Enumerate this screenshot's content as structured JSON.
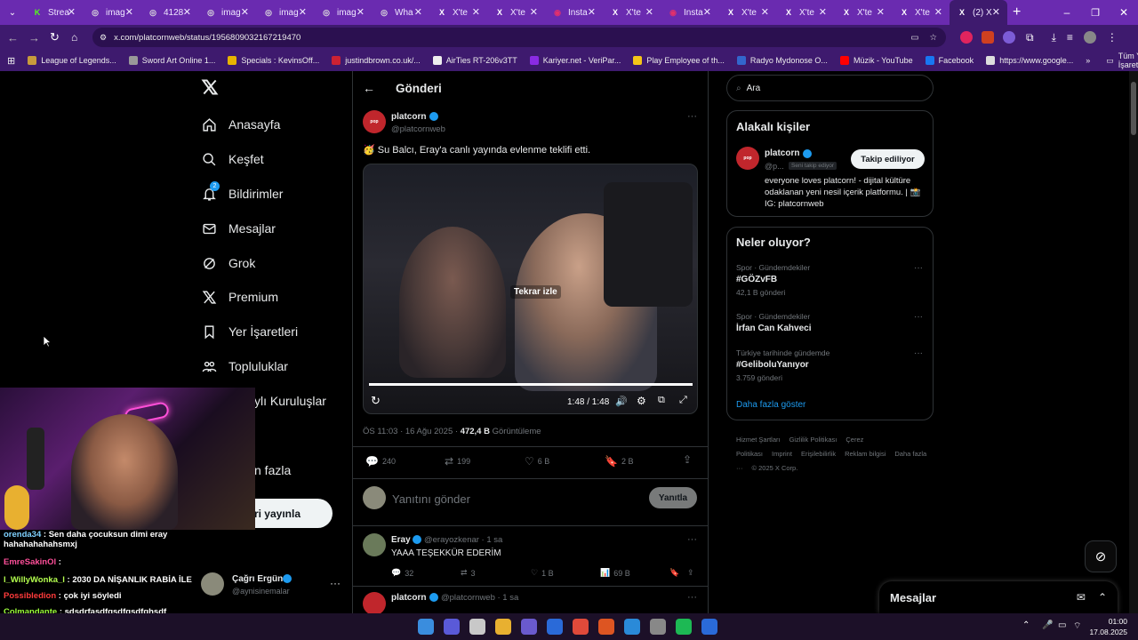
{
  "browser": {
    "tabs": [
      {
        "title": "Strea",
        "fav": "K",
        "color": "#53fc18"
      },
      {
        "title": "imag",
        "fav": "◎",
        "color": "#ddd"
      },
      {
        "title": "4128",
        "fav": "◎",
        "color": "#ddd"
      },
      {
        "title": "imag",
        "fav": "◎",
        "color": "#ddd"
      },
      {
        "title": "imag",
        "fav": "◎",
        "color": "#ddd"
      },
      {
        "title": "imag",
        "fav": "◎",
        "color": "#ddd"
      },
      {
        "title": "Wha",
        "fav": "◎",
        "color": "#ddd"
      },
      {
        "title": "X'te",
        "fav": "X",
        "color": "#fff"
      },
      {
        "title": "X'te",
        "fav": "X",
        "color": "#fff"
      },
      {
        "title": "Insta",
        "fav": "◉",
        "color": "#e1306c"
      },
      {
        "title": "X'te",
        "fav": "X",
        "color": "#fff"
      },
      {
        "title": "Insta",
        "fav": "◉",
        "color": "#e1306c"
      },
      {
        "title": "X'te",
        "fav": "X",
        "color": "#fff"
      },
      {
        "title": "X'te",
        "fav": "X",
        "color": "#fff"
      },
      {
        "title": "X'te",
        "fav": "X",
        "color": "#fff"
      },
      {
        "title": "X'te",
        "fav": "X",
        "color": "#fff"
      },
      {
        "title": "(2) X",
        "fav": "X",
        "color": "#fff"
      }
    ],
    "url": "x.com/platcornweb/status/1956809032167219470",
    "bookmarks": [
      {
        "label": "League of Legends...",
        "color": "#c89b3c"
      },
      {
        "label": "Sword Art Online 1...",
        "color": "#999"
      },
      {
        "label": "Specials : KevinsOff...",
        "color": "#e8b400"
      },
      {
        "label": "justindbrown.co.uk/...",
        "color": "#c23"
      },
      {
        "label": "AirTies RT-206v3TT",
        "color": "#eee"
      },
      {
        "label": "Kariyer.net - VeriPar...",
        "color": "#8a2be2"
      },
      {
        "label": "Play Employee of th...",
        "color": "#f5c518"
      },
      {
        "label": "Radyo Mydonose O...",
        "color": "#36c"
      },
      {
        "label": "Müzik - YouTube",
        "color": "#f00"
      },
      {
        "label": "Facebook",
        "color": "#1877f2"
      },
      {
        "label": "https://www.google...",
        "color": "#ddd"
      }
    ],
    "all_bookmarks": "Tüm Yer İşaretleri"
  },
  "sidebar": {
    "items": [
      {
        "label": "Anasayfa",
        "icon": "home-icon"
      },
      {
        "label": "Keşfet",
        "icon": "search-icon"
      },
      {
        "label": "Bildirimler",
        "icon": "bell-icon"
      },
      {
        "label": "Mesajlar",
        "icon": "mail-icon"
      },
      {
        "label": "Grok",
        "icon": "grok-icon"
      },
      {
        "label": "Premium",
        "icon": "x-icon"
      },
      {
        "label": "Yer İşaretleri",
        "icon": "bookmark-icon"
      },
      {
        "label": "Topluluklar",
        "icon": "people-icon"
      },
      {
        "label": "ylı Kuruluşlar",
        "icon": ""
      },
      {
        "label": "n fazla",
        "icon": ""
      }
    ],
    "notif_badge": "2",
    "post_button": "eri yayınla",
    "account": {
      "name": "Çağrı Ergün",
      "handle": "@aynisinemalar"
    }
  },
  "main": {
    "header": "Gönderi",
    "author": {
      "name": "platcorn",
      "handle": "@platcornweb"
    },
    "text": "🥳 Su Balcı, Eray'a canlı yayında evlenme teklifi etti.",
    "video": {
      "replay": "Tekrar izle",
      "time": "1:48 / 1:48",
      "progress": 1.0
    },
    "meta": {
      "time": "ÖS 11:03 · 16 Ağu 2025 · ",
      "views": "472,4 B",
      "views_label": " Görüntüleme"
    },
    "actions": {
      "replies": "240",
      "reposts": "199",
      "likes": "6 B",
      "bookmarks": "2 B"
    },
    "reply_placeholder": "Yanıtını gönder",
    "reply_button": "Yanıtla",
    "reply1": {
      "name": "Eray",
      "handle": "@erayozkenar · 1 sa",
      "text": "YAAA TEŞEKKÜR EDERİM",
      "replies": "32",
      "reposts": "3",
      "likes": "1 B",
      "views": "69 B"
    },
    "reply2": {
      "name": "platcorn",
      "handle": "@platcornweb · 1 sa"
    }
  },
  "right": {
    "search_placeholder": "Ara",
    "relevant": {
      "title": "Alakalı kişiler",
      "name": "platcorn",
      "handle": "@p...",
      "follows_you": "Seni takip ediyor",
      "follow_button": "Takip ediliyor",
      "bio": "everyone loves platcorn! - dijital kültüre odaklanan yeni nesil içerik platformu. | 📸 IG: platcornweb"
    },
    "trends": {
      "title": "Neler oluyor?",
      "items": [
        {
          "context": "Spor · Gündemdekiler",
          "name": "#GÖZvFB",
          "count": "42,1 B gönderi"
        },
        {
          "context": "Spor · Gündemdekiler",
          "name": "İrfan Can Kahveci",
          "count": ""
        },
        {
          "context": "Türkiye tarihinde gündemde",
          "name": "#GeliboluYanıyor",
          "count": "3.759 gönderi"
        }
      ],
      "show_more": "Daha fazla göster"
    },
    "footer": [
      "Hizmet Şartları",
      "Gizlilik Politikası",
      "Çerez Politikası",
      "Imprint",
      "Erişilebilirlik",
      "Reklam bilgisi",
      "Daha fazla ···",
      "© 2025 X Corp."
    ],
    "messages_drawer": "Mesajlar"
  },
  "overlay_chat": [
    {
      "user": "orenda34",
      "msg": "Sen daha çocuksun dimi eray hahahahahahsmxj",
      "color": "#7fd1ff"
    },
    {
      "user": "EmreSakinOl",
      "msg": "",
      "color": "#ff4f9a"
    },
    {
      "user": "l_WillyWonka_l",
      "msg": "2030 DA NİŞANLIK RABİA İLE",
      "color": "#b4ff4f"
    },
    {
      "user": "Possibledion",
      "msg": "çok iyi söyledi",
      "color": "#ff3b3b"
    },
    {
      "user": "Colmandante",
      "msg": "sdsdrfasdfgsdfgsdfghsdf",
      "color": "#9cff3b"
    }
  ],
  "taskbar": {
    "time": "01:00",
    "date": "17.08.2025"
  }
}
